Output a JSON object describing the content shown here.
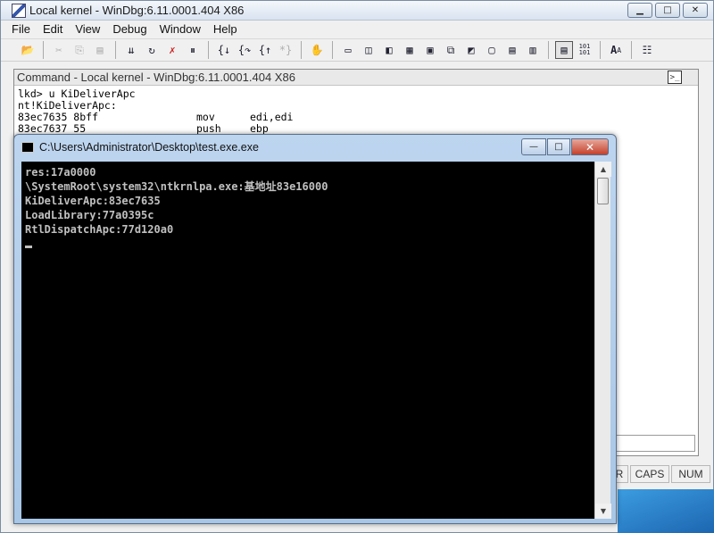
{
  "windbg": {
    "title": "Local kernel - WinDbg:6.11.0001.404 X86",
    "menu": [
      "File",
      "Edit",
      "View",
      "Debug",
      "Window",
      "Help"
    ],
    "toolbar": [
      "open-icon",
      "cut-icon",
      "copy-icon",
      "paste-icon",
      "go-icon",
      "restart-icon",
      "stop-icon",
      "break-icon",
      "step-into-icon",
      "step-over-icon",
      "step-out-icon",
      "run-to-cursor-icon",
      "hand-icon",
      "command-icon",
      "watch-icon",
      "locals-icon",
      "registers-icon",
      "memory-icon",
      "call-stack-icon",
      "disassembly-icon",
      "scratch-pad-icon",
      "processes-icon",
      "source-mode-icon",
      "hex-icon",
      "font-icon",
      "options-icon"
    ],
    "binary_label": "101\n101",
    "font_label": "A",
    "command_window": {
      "title": "Command - Local kernel - WinDbg:6.11.0001.404 X86",
      "lines": [
        "lkd> u KiDeliverApc",
        "nt!KiDeliverApc:"
      ],
      "asm": [
        {
          "addr": "83ec7635 8bff",
          "op": "mov",
          "args": "edi,edi"
        },
        {
          "addr": "83ec7637 55",
          "op": "push",
          "args": "ebp"
        }
      ]
    },
    "status": {
      "partial": "R",
      "caps": "CAPS",
      "num": "NUM"
    }
  },
  "console": {
    "title": "C:\\Users\\Administrator\\Desktop\\test.exe.exe",
    "lines": [
      "res:17a0000",
      "\\SystemRoot\\system32\\ntkrnlpa.exe:基地址83e16000",
      "KiDeliverApc:83ec7635",
      "LoadLibrary:77a0395c",
      "RtlDispatchApc:77d120a0"
    ],
    "buttons": {
      "minimize": "—",
      "maximize": "□",
      "close": "✕"
    }
  },
  "icons": {
    "window_min": "▁",
    "window_max": "□",
    "window_close": "✕",
    "scroll_up": "▲",
    "scroll_down": "▼"
  }
}
